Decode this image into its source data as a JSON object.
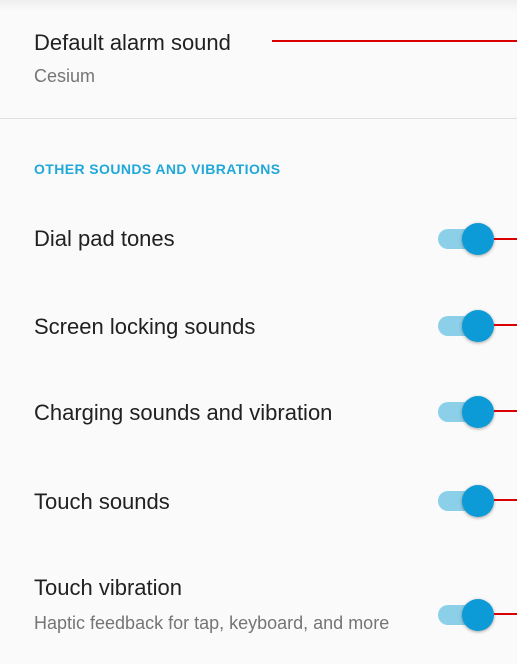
{
  "alarm": {
    "title": "Default alarm sound",
    "summary": "Cesium"
  },
  "section": {
    "header": "OTHER SOUNDS AND VIBRATIONS"
  },
  "settings": [
    {
      "title": "Dial pad tones",
      "summary": "",
      "enabled": true
    },
    {
      "title": "Screen locking sounds",
      "summary": "",
      "enabled": true
    },
    {
      "title": "Charging sounds and vibration",
      "summary": "",
      "enabled": true
    },
    {
      "title": "Touch sounds",
      "summary": "",
      "enabled": true
    },
    {
      "title": "Touch vibration",
      "summary": "Haptic feedback for tap, keyboard, and more",
      "enabled": true
    }
  ],
  "colors": {
    "accent": "#0c9bd6",
    "track": "#8ccfe8",
    "annotation": "#d80000",
    "background": "#fafafa"
  }
}
